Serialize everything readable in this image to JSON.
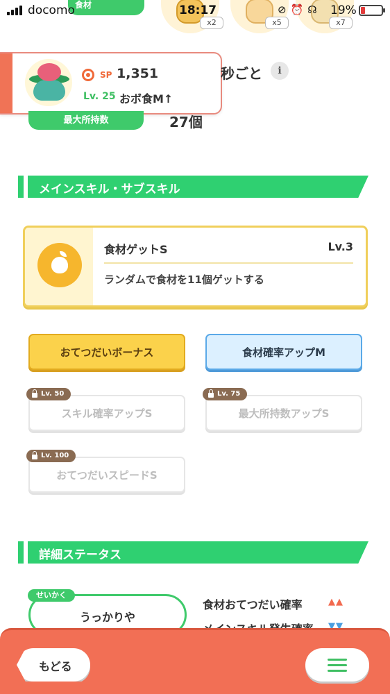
{
  "status_bar": {
    "carrier": "docomo",
    "time": "18:17",
    "battery": "19%",
    "battery_level": 0.19
  },
  "top_strip": {
    "food_tab_label": "食材",
    "ingredient_counts": [
      "x2",
      "x5",
      "x7"
    ]
  },
  "pokemon_card": {
    "sp_label": "SP",
    "sp_value": "1,351",
    "level": "Lv. 25",
    "sub_label": "おボ食M↑"
  },
  "help": {
    "per_text": "秒ごと",
    "info_icon_label": "i"
  },
  "max_capacity": {
    "label": "最大所持数",
    "value": "27個"
  },
  "skills_section": {
    "title": "メインスキル・サブスキル",
    "main_skill": {
      "name": "食材ゲットS",
      "level": "Lv.3",
      "description": "ランダムで食材を11個ゲットする",
      "icon": "apple-icon"
    },
    "sub_skills": [
      {
        "label": "おてつだいボーナス",
        "style": "gold"
      },
      {
        "label": "食材確率アップM",
        "style": "blue"
      },
      {
        "label": "スキル確率アップS",
        "style": "locked",
        "lock_level": "Lv. 50"
      },
      {
        "label": "最大所持数アップS",
        "style": "locked",
        "lock_level": "Lv. 75"
      },
      {
        "label": "おてつだいスピードS",
        "style": "locked",
        "lock_level": "Lv. 100"
      }
    ]
  },
  "details_section": {
    "title": "詳細ステータス",
    "nature_tag": "せいかく",
    "nature_value": "うっかりや",
    "stats": [
      {
        "label": "食材おてつだい確率",
        "arrows": "▲▲",
        "color": "#f26a4f"
      },
      {
        "label": "メインスキル発生確率",
        "arrows": "▼▼",
        "color": "#4a9ee0"
      }
    ]
  },
  "bottom_bar": {
    "back_label": "もどる",
    "menu_icon": "hamburger-menu-icon"
  },
  "colors": {
    "accent_green": "#2fd071",
    "bottom_bar": "#f26f55",
    "gold": "#fbd24b",
    "blue": "#dcf0ff"
  }
}
